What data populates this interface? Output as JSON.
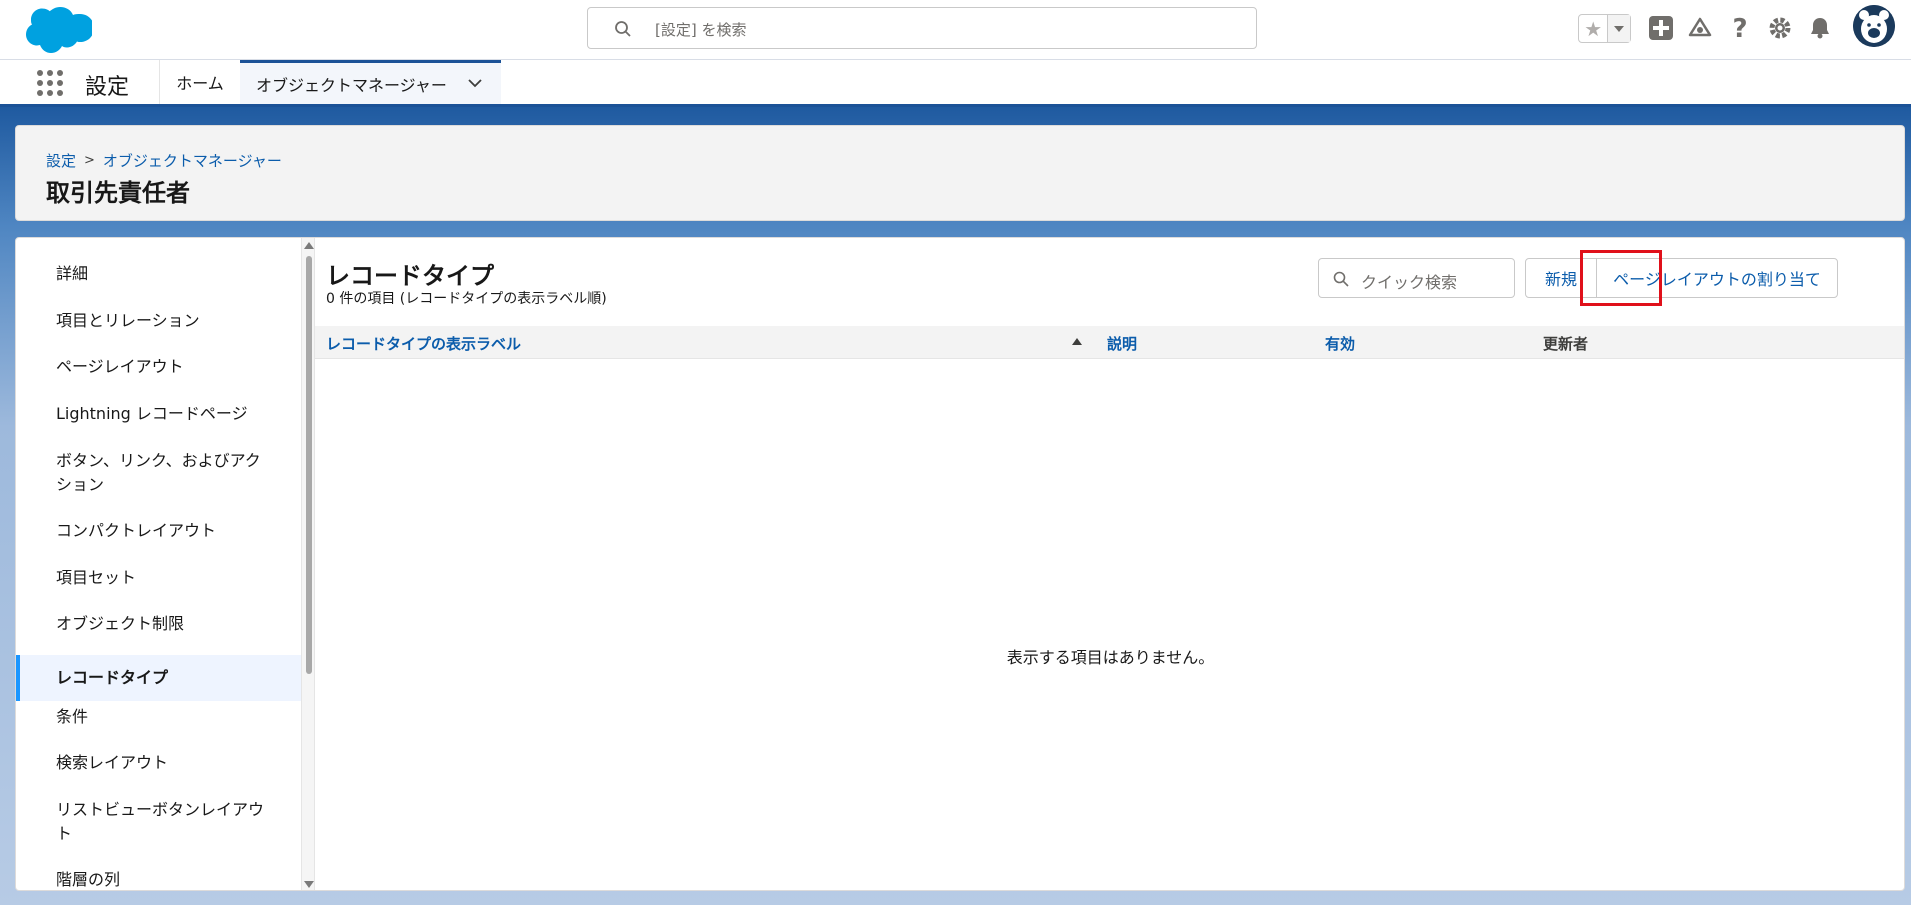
{
  "header": {
    "search_placeholder": "[設定] を検索"
  },
  "context_bar": {
    "app_name": "設定",
    "tabs": [
      {
        "label": "ホーム"
      },
      {
        "label": "オブジェクトマネージャー"
      }
    ]
  },
  "page_header": {
    "breadcrumb": [
      "設定",
      "オブジェクトマネージャー"
    ],
    "breadcrumb_separator": ">",
    "title": "取引先責任者"
  },
  "sidebar": {
    "items": [
      {
        "label": "詳細"
      },
      {
        "label": "項目とリレーション"
      },
      {
        "label": "ページレイアウト"
      },
      {
        "label": "Lightning レコードページ"
      },
      {
        "label": "ボタン、リンク、およびアク"
      },
      {
        "label": "ション"
      },
      {
        "label": "コンパクトレイアウト"
      },
      {
        "label": "項目セット"
      },
      {
        "label": "オブジェクト制限"
      },
      {
        "label": "レコードタイプ"
      },
      {
        "label": "条件"
      },
      {
        "label": "検索レイアウト"
      },
      {
        "label": "リストビューボタンレイアウ"
      },
      {
        "label": "ト"
      },
      {
        "label": "階層の列"
      }
    ],
    "active": "レコードタイプ"
  },
  "content": {
    "title": "レコードタイプ",
    "subtitle": "0 件の項目 (レコードタイプの表示ラベル順)",
    "quick_search_placeholder": "クイック検索",
    "new_button": "新規",
    "assign_button": "ページレイアウトの割り当て",
    "columns": [
      "レコードタイプの表示ラベル",
      "説明",
      "有効",
      "更新者"
    ],
    "empty_message": "表示する項目はありません。"
  },
  "colors": {
    "brand_blue": "#0b5cab",
    "nav_accent": "#1b5297",
    "active_item_bar": "#1b96ff",
    "highlight_red": "#e0101a"
  }
}
